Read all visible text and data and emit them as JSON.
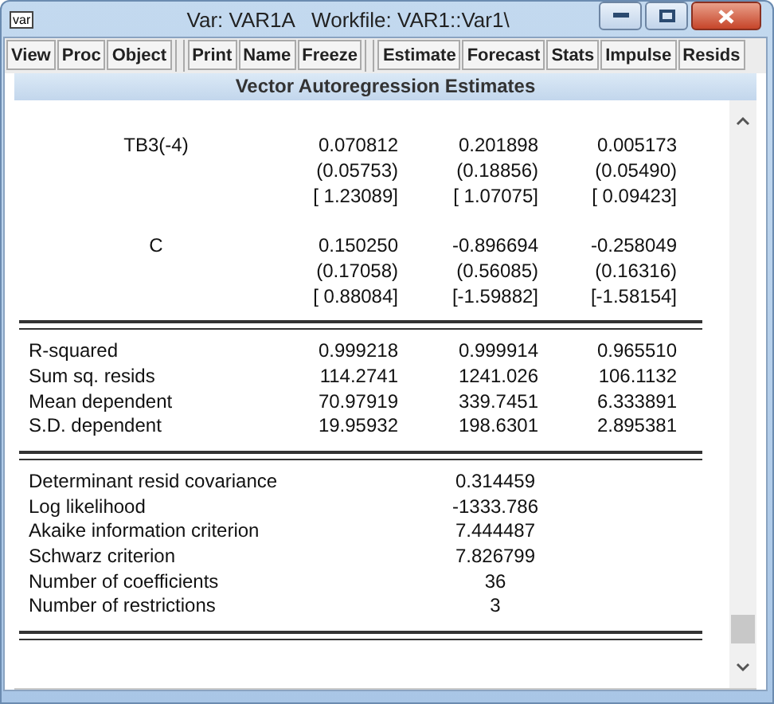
{
  "window": {
    "icon_label": "var",
    "title": "Var: VAR1A   Workfile: VAR1::Var1\\"
  },
  "toolbar": [
    [
      "View",
      "Proc",
      "Object"
    ],
    [
      "Print",
      "Name",
      "Freeze"
    ],
    [
      "Estimate",
      "Forecast",
      "Stats",
      "Impulse",
      "Resids"
    ]
  ],
  "header": "Vector Autoregression Estimates",
  "coefficients": [
    {
      "label": "TB3(-4)",
      "coef": [
        "0.070812",
        "0.201898",
        "0.005173"
      ],
      "se": [
        "(0.05753)",
        "(0.18856)",
        "(0.05490)"
      ],
      "t": [
        "[ 1.23089]",
        "[ 1.07075]",
        "[ 0.09423]"
      ]
    },
    {
      "label": "C",
      "coef": [
        "0.150250",
        "-0.896694",
        "-0.258049"
      ],
      "se": [
        "(0.17058)",
        "(0.56085)",
        "(0.16316)"
      ],
      "t": [
        "[ 0.88084]",
        "[-1.59882]",
        "[-1.58154]"
      ]
    }
  ],
  "equation_stats": [
    {
      "label": "R-squared",
      "values": [
        "0.999218",
        "0.999914",
        "0.965510"
      ]
    },
    {
      "label": "Sum sq. resids",
      "values": [
        "114.2741",
        "1241.026",
        "106.1132"
      ]
    },
    {
      "label": "Mean dependent",
      "values": [
        "70.97919",
        "339.7451",
        "6.333891"
      ]
    },
    {
      "label": "S.D. dependent",
      "values": [
        "19.95932",
        "198.6301",
        "2.895381"
      ]
    }
  ],
  "system_stats": [
    {
      "label": "Determinant resid covariance",
      "value": "0.314459"
    },
    {
      "label": "Log likelihood",
      "value": "-1333.786"
    },
    {
      "label": "Akaike information criterion",
      "value": "7.444487"
    },
    {
      "label": "Schwarz criterion",
      "value": "7.826799"
    },
    {
      "label": "Number of coefficients",
      "value": "36"
    },
    {
      "label": "Number of restrictions",
      "value": "3"
    }
  ]
}
